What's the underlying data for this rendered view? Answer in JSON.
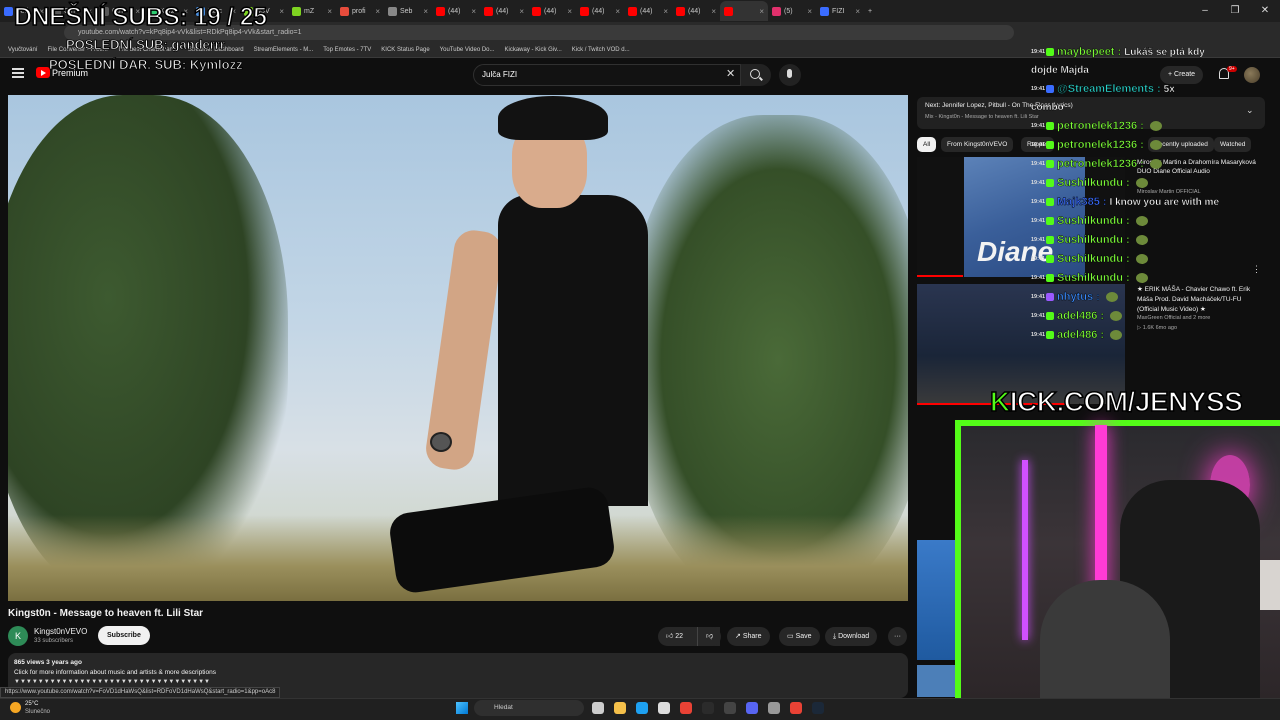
{
  "browser": {
    "tabs": [
      {
        "label": "Betl",
        "color": "#3a6cff"
      },
      {
        "label": "Ctrl",
        "color": "#5a5a5a"
      },
      {
        "label": "Ctrl",
        "color": "#5a5a5a"
      },
      {
        "label": "Kurz",
        "color": "#2ecc71"
      },
      {
        "label": "Najc",
        "color": "#4a90e2"
      },
      {
        "label": "w3V",
        "color": "#7ed321"
      },
      {
        "label": "mZ",
        "color": "#7ed321"
      },
      {
        "label": "profi",
        "color": "#e74c3c"
      },
      {
        "label": "Seb",
        "color": "#888888"
      },
      {
        "label": "(44)",
        "color": "#ff0000"
      },
      {
        "label": "(44)",
        "color": "#ff0000"
      },
      {
        "label": "(44)",
        "color": "#ff0000"
      },
      {
        "label": "(44)",
        "color": "#ff0000"
      },
      {
        "label": "(44)",
        "color": "#ff0000"
      },
      {
        "label": "(44)",
        "color": "#ff0000"
      },
      {
        "label": "",
        "color": "#ff0000",
        "active": true
      },
      {
        "label": "(5)",
        "color": "#e1306c"
      },
      {
        "label": "FIZI",
        "color": "#3a6cff"
      }
    ],
    "new_tab": "+",
    "window_controls": [
      "–",
      "❐",
      "✕"
    ],
    "url": "youtube.com/watch?v=kPq8ip4-vVk&list=RDkPq8ip4-vVk&start_radio=1",
    "bookmarks": [
      "Vyučtování",
      "File Converter - Free...",
      "The best ChatBot an...",
      "Streamer Dashboard",
      "StreamElements - M...",
      "Top Emotes - 7TV",
      "KICK Status Page",
      "YouTube Video Do...",
      "Kickaway - Kick Giv...",
      "Kick / Twitch VOD d..."
    ]
  },
  "youtube": {
    "premium_label": "Premium",
    "search_value": "Julča FIZI",
    "create_label": "Create",
    "notif_count": "9+",
    "video": {
      "title": "Kingst0n - Message to heaven ft. Lili Star",
      "channel": "Kingst0nVEVO",
      "channel_initial": "K",
      "subscribers": "33 subscribers",
      "subscribe_label": "Subscribe",
      "likes": "22",
      "share_label": "Share",
      "save_label": "Save",
      "download_label": "Download",
      "more_label": "···",
      "views": "865 views  3 years ago",
      "description": "Click for more information about music and artists & more descriptions",
      "desc_arrows": "▼▼▼▼▼▼▼▼▼▼▼▼▼▼▼▼▼▼▼▼▼▼▼▼▼▼▼▼▼▼▼▼▼"
    },
    "status_url": "https://www.youtube.com/watch?v=FoVD1dHaWsQ&list=RDFoVD1dHaWsQ&start_radio=1&pp=oAc8",
    "up_next": {
      "title": "Next: Jennifer Lopez, Pitbull - On The Floor (Lyrics)",
      "sub": "Mix - Kingst0n - Message to heaven ft. Lili Star"
    },
    "chips": [
      "All",
      "From Kingst0nVEVO",
      "Rapper",
      "Recently uploaded",
      "Watched"
    ],
    "related": [
      {
        "title": "Miroslav Martin a Drahomíra Masaryková DUO Diane  Official Audio",
        "channel": "Miroslav Martin OFFICIAL",
        "thumb_text": "Diane"
      },
      {
        "title": "★ ERIK MÁŠA - Chavier Chawo ft. Erik Máša Prod. David Macháček/TU-FU (Official Music Video) ★",
        "channel": "MaxGreen Official and 2 more",
        "meta": "▷ 1.6K  6mo ago"
      }
    ]
  },
  "stream_overlay": {
    "subs_counter": "DNEŠNÍ SUBS: 19 / 25",
    "last_sub": "POSLEDNÍ SUB: ganderrr",
    "last_gift": "POSLEDNÍ DAR. SUB: Kymlozz",
    "kick_url_k": "K",
    "kick_url_rest": "ICK.COM/JENYSS",
    "accent": "#53fc18"
  },
  "chat": [
    {
      "time": "19:41",
      "user": "maybepeet",
      "color": "#7fff3a",
      "msg": "Lukáš se ptá kdy",
      "badge": "green"
    },
    {
      "time": "",
      "user": "",
      "color": "#ffffff",
      "msg": "dojde Majda",
      "badge": ""
    },
    {
      "time": "19:41",
      "user": "@StreamElements",
      "color": "#2ad1c9",
      "msg": "5x",
      "badge": "blue"
    },
    {
      "time": "",
      "user": "",
      "color": "#ffffff",
      "msg": "combo",
      "badge": ""
    },
    {
      "time": "19:41",
      "user": "petronelek1236",
      "color": "#7fff3a",
      "msg": "",
      "badge": "green"
    },
    {
      "time": "19:41",
      "user": "petronelek1236",
      "color": "#7fff3a",
      "msg": "",
      "badge": "green"
    },
    {
      "time": "19:41",
      "user": "petronelek1236",
      "color": "#7fff3a",
      "msg": "",
      "badge": "green"
    },
    {
      "time": "19:41",
      "user": "Sushilkundu",
      "color": "#7fff3a",
      "msg": "",
      "badge": "green"
    },
    {
      "time": "19:41",
      "user": "Majk385",
      "color": "#3a6cff",
      "msg": "I know you are with me",
      "badge": "green"
    },
    {
      "time": "19:41",
      "user": "Sushilkundu",
      "color": "#7fff3a",
      "msg": "",
      "badge": "green"
    },
    {
      "time": "19:41",
      "user": "Sushilkundu",
      "color": "#7fff3a",
      "msg": "",
      "badge": "green"
    },
    {
      "time": "19:41",
      "user": "Sushilkundu",
      "color": "#7fff3a",
      "msg": "",
      "badge": "green"
    },
    {
      "time": "19:41",
      "user": "Sushilkundu",
      "color": "#7fff3a",
      "msg": "",
      "badge": "green"
    },
    {
      "time": "19:41",
      "user": "nhytus",
      "color": "#3a8cff",
      "msg": "",
      "badge": "purple"
    },
    {
      "time": "19:41",
      "user": "adel486",
      "color": "#7fff3a",
      "msg": "",
      "badge": "green"
    },
    {
      "time": "19:41",
      "user": "adel486",
      "color": "#7fff3a",
      "msg": "",
      "badge": "green"
    }
  ],
  "taskbar": {
    "weather_temp": "25°C",
    "weather_desc": "Slunečno",
    "search_placeholder": "Hledat",
    "icons": [
      {
        "name": "task-view-icon",
        "color": "#cccccc"
      },
      {
        "name": "file-explorer-icon",
        "color": "#f5c04a"
      },
      {
        "name": "edge-icon",
        "color": "#1ea1f1"
      },
      {
        "name": "store-icon",
        "color": "#dddddd"
      },
      {
        "name": "chrome-icon",
        "color": "#e94235"
      },
      {
        "name": "terminal-icon",
        "color": "#2b2b2b"
      },
      {
        "name": "obs-icon",
        "color": "#444444"
      },
      {
        "name": "discord-icon",
        "color": "#5865f2"
      },
      {
        "name": "settings-icon",
        "color": "#999999"
      },
      {
        "name": "chrome-active-icon",
        "color": "#e94235"
      },
      {
        "name": "steam-icon",
        "color": "#1b2838"
      }
    ]
  }
}
